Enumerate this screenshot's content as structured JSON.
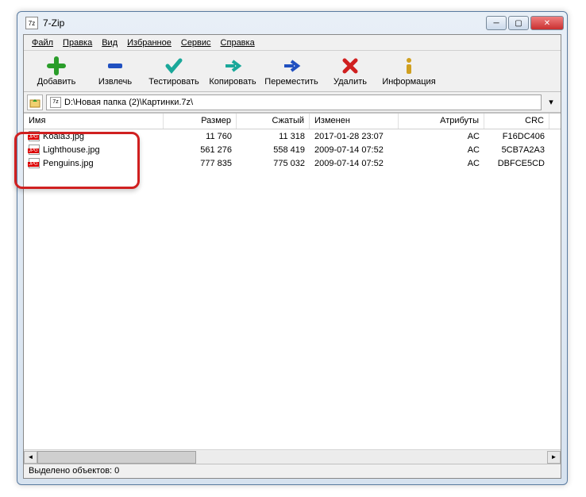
{
  "window": {
    "title": "7-Zip"
  },
  "menu": {
    "file": "Файл",
    "edit": "Правка",
    "view": "Вид",
    "favorites": "Избранное",
    "tools": "Сервис",
    "help": "Справка"
  },
  "toolbar": {
    "add": "Добавить",
    "extract": "Извлечь",
    "test": "Тестировать",
    "copy": "Копировать",
    "move": "Переместить",
    "delete": "Удалить",
    "info": "Информация"
  },
  "address": {
    "path": "D:\\Новая папка (2)\\Картинки.7z\\"
  },
  "columns": {
    "name": "Имя",
    "size": "Размер",
    "packed": "Сжатый",
    "modified": "Изменен",
    "attributes": "Атрибуты",
    "crc": "CRC"
  },
  "files": [
    {
      "name": "Koala3.jpg",
      "size": "11 760",
      "packed": "11 318",
      "modified": "2017-01-28 23:07",
      "attr": "AC",
      "crc": "F16DC406"
    },
    {
      "name": "Lighthouse.jpg",
      "size": "561 276",
      "packed": "558 419",
      "modified": "2009-07-14 07:52",
      "attr": "AC",
      "crc": "5CB7A2A3"
    },
    {
      "name": "Penguins.jpg",
      "size": "777 835",
      "packed": "775 032",
      "modified": "2009-07-14 07:52",
      "attr": "AC",
      "crc": "DBFCE5CD"
    }
  ],
  "status": {
    "text": "Выделено объектов: 0"
  }
}
